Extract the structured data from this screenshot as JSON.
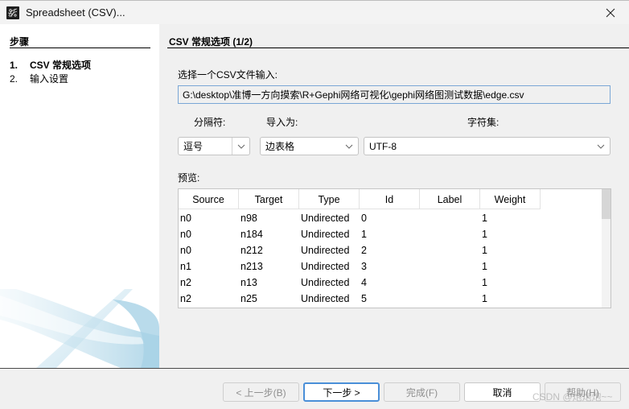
{
  "window": {
    "title": "Spreadsheet (CSV)...",
    "app_icon": "gephi-logo-icon",
    "close_icon": "close-icon"
  },
  "steps": {
    "title": "步骤",
    "items": [
      {
        "num": "1.",
        "label": "CSV 常规选项",
        "active": true
      },
      {
        "num": "2.",
        "label": "输入设置",
        "active": false
      }
    ]
  },
  "main": {
    "section_title": "CSV 常规选项 (1/2)",
    "file_label": "选择一个CSV文件输入:",
    "file_path": "G:\\desktop\\准博一方向摸索\\R+Gephi网络可视化\\gephi网络图测试数据\\edge.csv",
    "separator_label": "分隔符:",
    "separator_value": "逗号",
    "import_as_label": "导入为:",
    "import_as_value": "边表格",
    "charset_label": "字符集:",
    "charset_value": "UTF-8",
    "preview_label": "预览:"
  },
  "preview_table": {
    "columns": [
      "Source",
      "Target",
      "Type",
      "Id",
      "Label",
      "Weight"
    ],
    "rows": [
      [
        "n0",
        "n98",
        "Undirected",
        "0",
        "",
        "1"
      ],
      [
        "n0",
        "n184",
        "Undirected",
        "1",
        "",
        "1"
      ],
      [
        "n0",
        "n212",
        "Undirected",
        "2",
        "",
        "1"
      ],
      [
        "n1",
        "n213",
        "Undirected",
        "3",
        "",
        "1"
      ],
      [
        "n2",
        "n13",
        "Undirected",
        "4",
        "",
        "1"
      ],
      [
        "n2",
        "n25",
        "Undirected",
        "5",
        "",
        "1"
      ]
    ]
  },
  "buttons": {
    "back": "< 上一步(B)",
    "next": "下一步 >",
    "finish": "完成(F)",
    "cancel": "取消",
    "help": "帮助(H)"
  },
  "watermark": "CSDN @炮炮炮~~",
  "colors": {
    "accent": "#4a8fd8",
    "input_border": "#7aa7d6"
  }
}
